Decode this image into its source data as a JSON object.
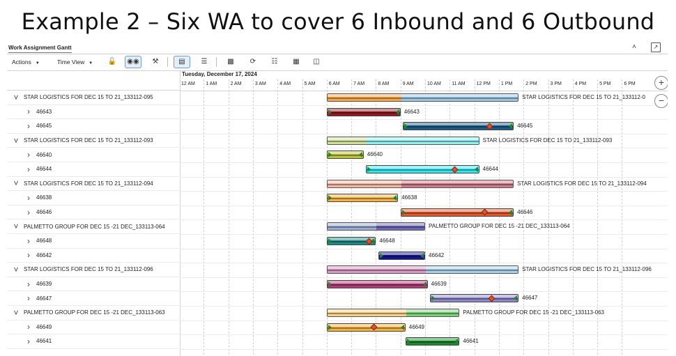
{
  "slide_title": "Example 2 – Six WA to cover 6 Inbound and 6 Outbound",
  "app": {
    "title": "Work Assignment Gantt",
    "header_icons": [
      "collapse-up-icon",
      "external-open-icon"
    ]
  },
  "toolbar": {
    "actions_label": "Actions",
    "time_view_label": "Time View",
    "buttons": [
      "unlock-icon",
      "binoculars-icon",
      "wrench-icon",
      "details-icon",
      "list-icon",
      "align-icon",
      "refresh-icon",
      "filter-list-icon",
      "calendar-icon",
      "gantt-icon"
    ]
  },
  "chart": {
    "date": "Tuesday, December 17, 2024",
    "hours": [
      "12 AM",
      "1 AM",
      "2 AM",
      "3 AM",
      "4 AM",
      "5 AM",
      "6 AM",
      "7 AM",
      "8 AM",
      "9 AM",
      "10 AM",
      "11 AM",
      "12 PM",
      "1 PM",
      "2 PM",
      "3 PM",
      "4 PM",
      "5 PM",
      "6 PM"
    ]
  },
  "rows": [
    {
      "type": "wa",
      "label": "STAR LOGISTICS FOR DEC 15 TO 21_133112-095",
      "bar_label": "STAR LOGISTICS FOR DEC 15 TO 21_133112-0",
      "start": 6.0,
      "end": 13.8,
      "split": 9.0,
      "colors": [
        "#f6a64a",
        "#9ec7e6"
      ]
    },
    {
      "type": "child",
      "label": "46643",
      "start": 6.0,
      "end": 9.0,
      "color": "#8f1a22",
      "marker": null
    },
    {
      "type": "child",
      "label": "46645",
      "start": 9.1,
      "end": 13.6,
      "color": "#1e5c88",
      "marker": 12.6
    },
    {
      "type": "wa",
      "label": "STAR LOGISTICS FOR DEC 15 TO 21_133112-093",
      "bar_label": "STAR LOGISTICS FOR DEC 15 TO 21_133112-093",
      "start": 6.0,
      "end": 12.2,
      "split": 7.6,
      "colors": [
        "#cfe09a",
        "#8ff0ef"
      ]
    },
    {
      "type": "child",
      "label": "46640",
      "start": 6.0,
      "end": 7.5,
      "color": "#bcc33c",
      "marker": null
    },
    {
      "type": "child",
      "label": "46644",
      "start": 7.6,
      "end": 12.2,
      "color": "#35e4f0",
      "marker": 11.2
    },
    {
      "type": "wa",
      "label": "STAR LOGISTICS FOR DEC 15 TO 21_133112-094",
      "bar_label": "STAR LOGISTICS FOR DEC 15 TO 21_133112-094",
      "start": 6.0,
      "end": 13.6,
      "split": 9.0,
      "colors": [
        "#f1b7a0",
        "#d07a8a"
      ]
    },
    {
      "type": "child",
      "label": "46638",
      "start": 6.0,
      "end": 8.9,
      "color": "#f6b23e",
      "marker": null
    },
    {
      "type": "child",
      "label": "46646",
      "start": 9.0,
      "end": 13.6,
      "color": "#e2582e",
      "marker": 12.4
    },
    {
      "type": "wa",
      "label": "PALMETTO GROUP FOR DEC 15 -21 DEC_133113-064",
      "bar_label": "PALMETTO GROUP FOR DEC 15 -21 DEC_133113-064",
      "start": 6.0,
      "end": 10.0,
      "split": 8.0,
      "colors": [
        "#9aaed0",
        "#6f69b5"
      ]
    },
    {
      "type": "child",
      "label": "46648",
      "start": 6.0,
      "end": 8.0,
      "color": "#1d8a86",
      "marker": 7.7
    },
    {
      "type": "child",
      "label": "46642",
      "start": 8.1,
      "end": 10.0,
      "color": "#14148c",
      "marker": null
    },
    {
      "type": "wa",
      "label": "STAR LOGISTICS FOR DEC 15 TO 21_133112-096",
      "bar_label": "STAR LOGISTICS FOR DEC 15 TO 21_133112-096",
      "start": 6.0,
      "end": 13.8,
      "split": 10.0,
      "colors": [
        "#d79ac0",
        "#a8d0e6"
      ]
    },
    {
      "type": "child",
      "label": "46639",
      "start": 6.0,
      "end": 10.1,
      "color": "#b23a78",
      "marker": null
    },
    {
      "type": "child",
      "label": "46647",
      "start": 10.2,
      "end": 13.8,
      "color": "#8e88cc",
      "marker": 12.7
    },
    {
      "type": "wa",
      "label": "PALMETTO GROUP FOR DEC 15 -21 DEC_133113-063",
      "bar_label": "PALMETTO GROUP FOR DEC 15 -21 DEC_133113-063",
      "start": 6.0,
      "end": 11.4,
      "split": 9.2,
      "colors": [
        "#f4d08a",
        "#7ccf7a"
      ]
    },
    {
      "type": "child",
      "label": "46649",
      "start": 6.0,
      "end": 9.2,
      "color": "#f6b23e",
      "marker": 7.9
    },
    {
      "type": "child",
      "label": "46641",
      "start": 9.2,
      "end": 11.4,
      "color": "#1c8a2a",
      "marker": null
    }
  ],
  "zoom": {
    "in": "+",
    "out": "−"
  }
}
